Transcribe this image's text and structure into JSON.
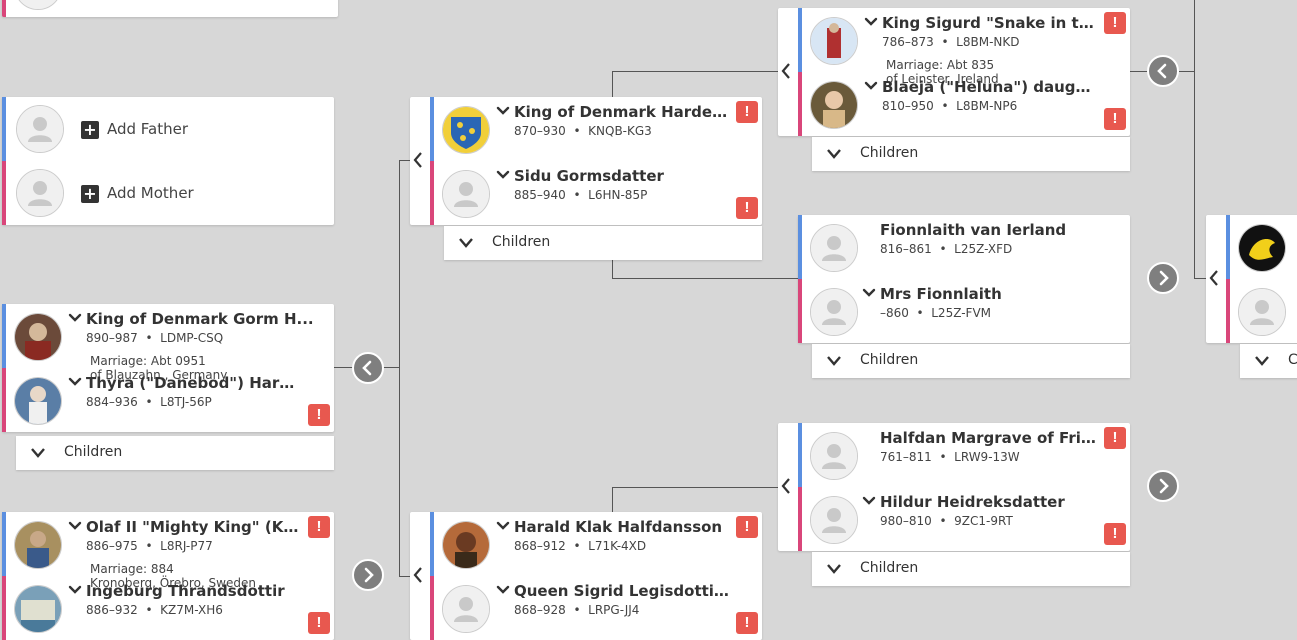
{
  "colors": {
    "father": "#5b8fe0",
    "mother": "#d9467a",
    "warning": "#e8584f",
    "background": "#d7d7d7"
  },
  "add_parents": {
    "father_label": "Add Father",
    "mother_label": "Add Mother"
  },
  "couples": {
    "gorm": {
      "husband": {
        "name": "King of Denmark Gorm H...",
        "years": "890–987",
        "id": "LDMP-CSQ"
      },
      "marriage": {
        "date": "Marriage: Abt 0951",
        "place": "of Blauzahn,, Germany"
      },
      "wife": {
        "name": "Thyra (\"Danebod\") Haral...",
        "years": "884–936",
        "id": "L8TJ-56P"
      },
      "children_label": "Children"
    },
    "olaf": {
      "husband": {
        "name": "Olaf II \"Mighty King\" (Ki...",
        "years": "886–975",
        "id": "L8RJ-P77"
      },
      "marriage": {
        "date": "Marriage: 884",
        "place": "Kronoberg, Örebro, Sweden"
      },
      "wife": {
        "name": "Ingeburg Thrandsdottir",
        "years": "886–932",
        "id": "KZ7M-XH6"
      }
    },
    "hardeknud": {
      "husband": {
        "name": "King of Denmark Hardek...",
        "years": "870–930",
        "id": "KNQB-KG3"
      },
      "wife": {
        "name": "Sidu Gormsdatter",
        "years": "885–940",
        "id": "L6HN-85P"
      },
      "children_label": "Children"
    },
    "harald": {
      "husband": {
        "name": "Harald Klak Halfdansson",
        "years": "868–912",
        "id": "L71K-4XD"
      },
      "wife": {
        "name": "Queen Sigrid Legisdottir ...",
        "years": "868–928",
        "id": "LRPG-JJ4"
      }
    },
    "sigurd": {
      "husband": {
        "name": "King Sigurd \"Snake in the...",
        "years": "786–873",
        "id": "L8BM-NKD"
      },
      "marriage": {
        "date": "Marriage: Abt 835",
        "place": "of Leinster, Ireland"
      },
      "wife": {
        "name": "Blaeja (\"Heluna\") daught...",
        "years": "810–950",
        "id": "L8BM-NP6"
      },
      "children_label": "Children"
    },
    "fionnlaith": {
      "husband": {
        "name": "Fionnlaith van Ierland",
        "years": "816–861",
        "id": "L25Z-XFD"
      },
      "wife": {
        "name": "Mrs Fionnlaith",
        "years": "–860",
        "id": "L25Z-FVM"
      },
      "children_label": "Children"
    },
    "halfdan": {
      "husband": {
        "name": "Halfdan Margrave of Frisia",
        "years": "761–811",
        "id": "LRW9-13W"
      },
      "wife": {
        "name": "Hildur Heidreksdatter",
        "years": "980–810",
        "id": "9ZC1-9RT"
      },
      "children_label": "Children"
    }
  },
  "partial": {
    "children_label_prefix": "C"
  },
  "icons": {
    "warning": "!",
    "plus": "+"
  }
}
